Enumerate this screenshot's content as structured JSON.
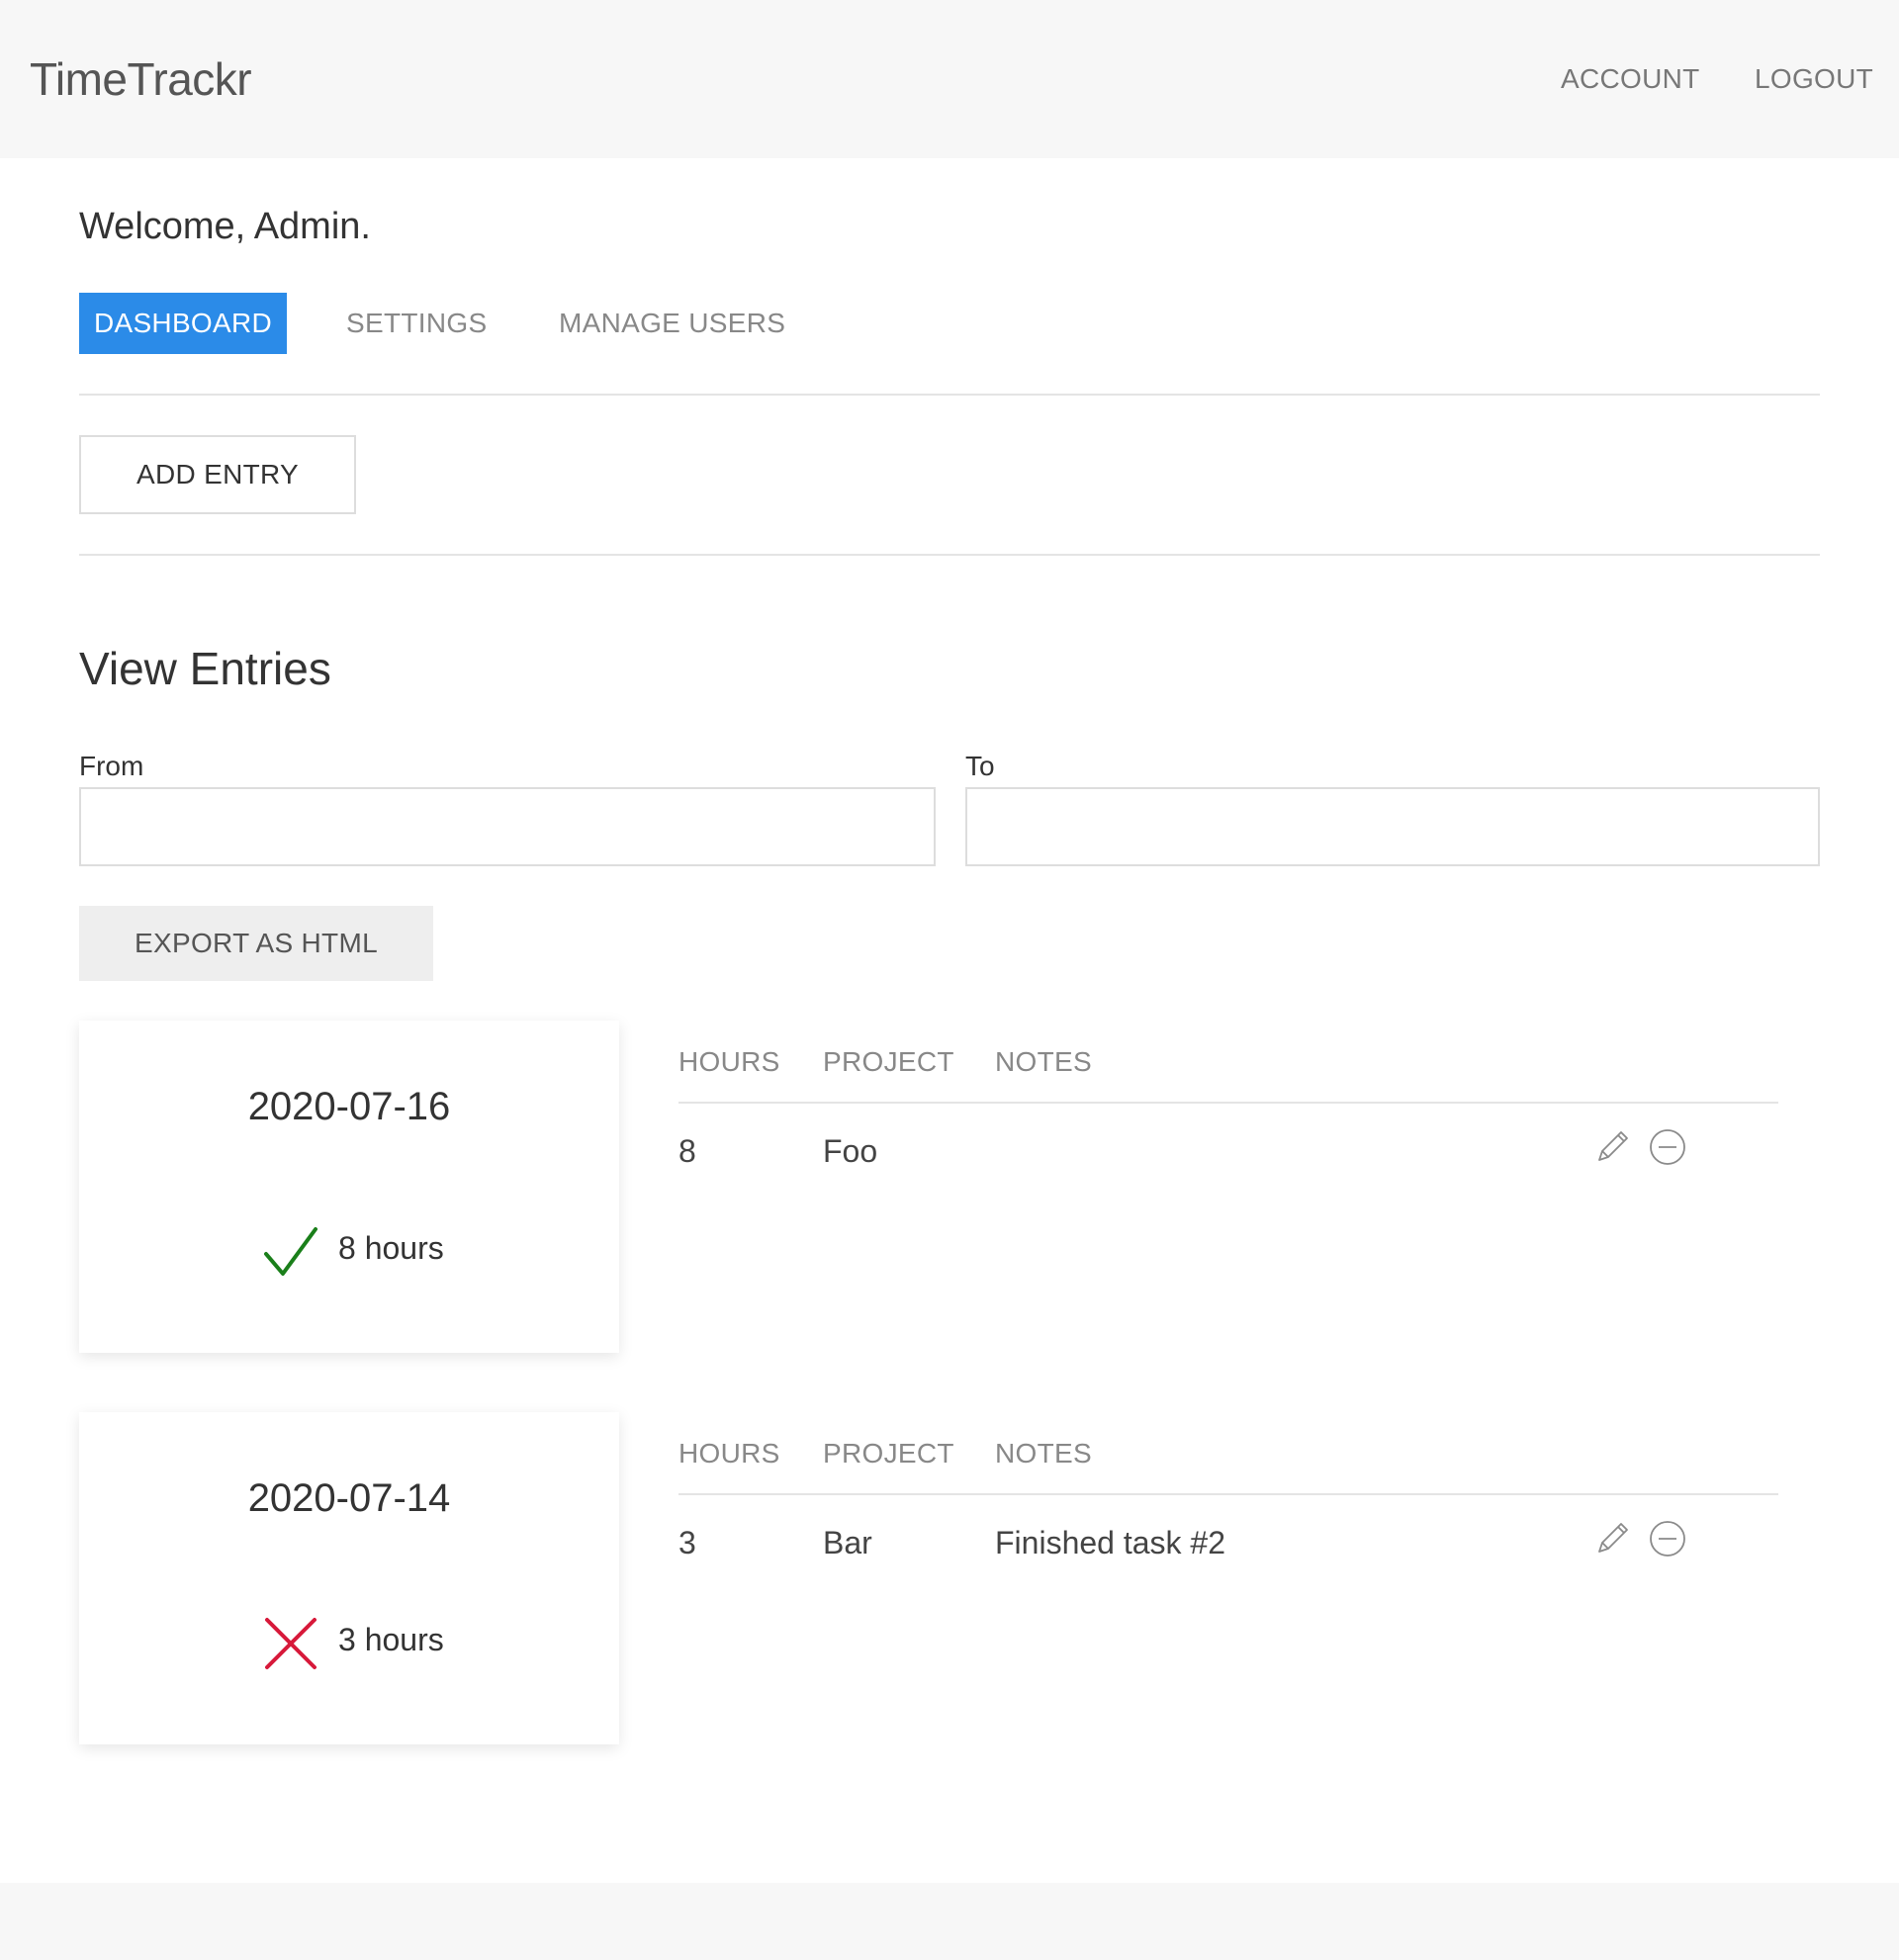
{
  "header": {
    "brand": "TimeTrackr",
    "nav": {
      "account": "ACCOUNT",
      "logout": "LOGOUT"
    }
  },
  "welcome": "Welcome, Admin.",
  "tabs": [
    {
      "label": "DASHBOARD",
      "active": true
    },
    {
      "label": "SETTINGS",
      "active": false
    },
    {
      "label": "MANAGE USERS",
      "active": false
    }
  ],
  "add_entry_label": "ADD ENTRY",
  "view_entries": {
    "title": "View Entries",
    "from_label": "From",
    "from_value": "",
    "to_label": "To",
    "to_value": "",
    "export_label": "EXPORT AS HTML"
  },
  "table_headers": {
    "hours": "HOURS",
    "project": "PROJECT",
    "notes": "NOTES"
  },
  "days": [
    {
      "date": "2020-07-16",
      "status": "check-icon",
      "status_color": "#1a7f1a",
      "total": "8 hours",
      "entries": [
        {
          "hours": "8",
          "project": "Foo",
          "notes": ""
        }
      ]
    },
    {
      "date": "2020-07-14",
      "status": "cross-icon",
      "status_color": "#d7193a",
      "total": "3 hours",
      "entries": [
        {
          "hours": "3",
          "project": "Bar",
          "notes": "Finished task #2"
        }
      ]
    }
  ],
  "colors": {
    "accent": "#2b8be8",
    "navbar_bg": "#f7f7f7",
    "divider": "#e4e4e4"
  }
}
